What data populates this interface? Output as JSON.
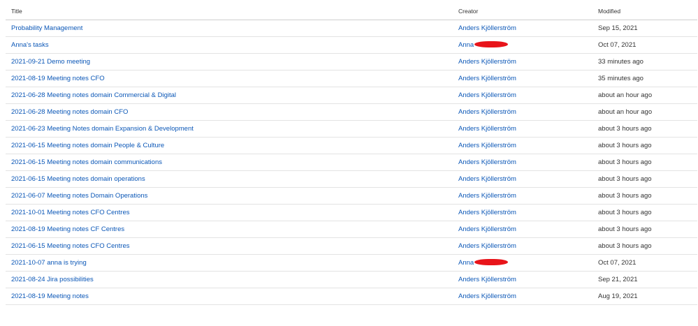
{
  "columns": {
    "title": "Title",
    "creator": "Creator",
    "modified": "Modified"
  },
  "rows": [
    {
      "title": "Probability Management",
      "creator": "Anders Kjöllerström",
      "redacted": false,
      "modified": "Sep 15, 2021"
    },
    {
      "title": "Anna's tasks",
      "creator": "Anna",
      "redacted": true,
      "modified": "Oct 07, 2021"
    },
    {
      "title": "2021-09-21 Demo meeting",
      "creator": "Anders Kjöllerström",
      "redacted": false,
      "modified": "33 minutes ago"
    },
    {
      "title": "2021-08-19 Meeting notes CFO",
      "creator": "Anders Kjöllerström",
      "redacted": false,
      "modified": "35 minutes ago"
    },
    {
      "title": "2021-06-28 Meeting notes domain Commercial & Digital",
      "creator": "Anders Kjöllerström",
      "redacted": false,
      "modified": "about an hour ago"
    },
    {
      "title": "2021-06-28 Meeting notes domain CFO",
      "creator": "Anders Kjöllerström",
      "redacted": false,
      "modified": "about an hour ago"
    },
    {
      "title": "2021-06-23 Meeting Notes domain Expansion & Development",
      "creator": "Anders Kjöllerström",
      "redacted": false,
      "modified": "about 3 hours ago"
    },
    {
      "title": "2021-06-15 Meeting notes domain People & Culture",
      "creator": "Anders Kjöllerström",
      "redacted": false,
      "modified": "about 3 hours ago"
    },
    {
      "title": "2021-06-15 Meeting notes domain communications",
      "creator": "Anders Kjöllerström",
      "redacted": false,
      "modified": "about 3 hours ago"
    },
    {
      "title": "2021-06-15 Meeting notes domain operations",
      "creator": "Anders Kjöllerström",
      "redacted": false,
      "modified": "about 3 hours ago"
    },
    {
      "title": "2021-06-07 Meeting notes Domain Operations",
      "creator": "Anders Kjöllerström",
      "redacted": false,
      "modified": "about 3 hours ago"
    },
    {
      "title": "2021-10-01 Meeting notes CFO Centres",
      "creator": "Anders Kjöllerström",
      "redacted": false,
      "modified": "about 3 hours ago"
    },
    {
      "title": "2021-08-19 Meeting notes CF Centres",
      "creator": "Anders Kjöllerström",
      "redacted": false,
      "modified": "about 3 hours ago"
    },
    {
      "title": "2021-06-15 Meeting notes CFO Centres",
      "creator": "Anders Kjöllerström",
      "redacted": false,
      "modified": "about 3 hours ago"
    },
    {
      "title": "2021-10-07 anna is trying",
      "creator": "Anna",
      "redacted": true,
      "modified": "Oct 07, 2021"
    },
    {
      "title": "2021-08-24 Jira possibilities",
      "creator": "Anders Kjöllerström",
      "redacted": false,
      "modified": "Sep 21, 2021"
    },
    {
      "title": "2021-08-19 Meeting notes",
      "creator": "Anders Kjöllerström",
      "redacted": false,
      "modified": "Aug 19, 2021"
    }
  ]
}
